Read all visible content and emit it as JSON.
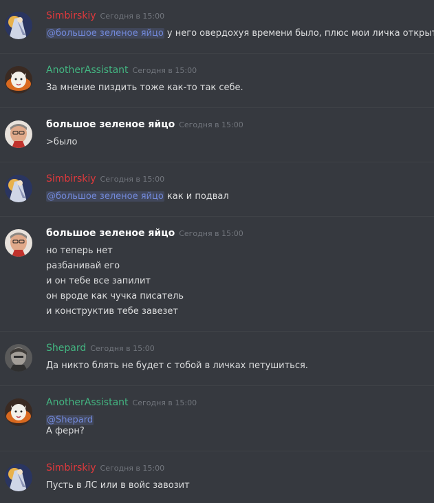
{
  "colors": {
    "background": "#36393f",
    "divider": "#3f4247",
    "timestamp": "#72767d",
    "text": "#dcddde",
    "mention": "#7289da",
    "simbirskiy": "#e0393c",
    "anotherassistant": "#43b581",
    "egg": "#ffffff",
    "shepard": "#43b581"
  },
  "messages": [
    {
      "author": "Simbirskiy",
      "timestamp": "Сегодня в 15:00",
      "mention": "@большое зеленое яйцо",
      "text": " у него овердохуя времени было, плюс мои личка открыта"
    },
    {
      "author": "AnotherAssistant",
      "timestamp": "Сегодня в 15:00",
      "text": "За мнение пиздить тоже как-то так себе."
    },
    {
      "author": "большое зеленое яйцо",
      "timestamp": "Сегодня в 15:00",
      "text": ">было"
    },
    {
      "author": "Simbirskiy",
      "timestamp": "Сегодня в 15:00",
      "mention": "@большое зеленое яйцо",
      "text": " как и подвал"
    },
    {
      "author": "большое зеленое яйцо",
      "timestamp": "Сегодня в 15:00",
      "lines": [
        "но теперь нет",
        "разбанивай его",
        "и он тебе все запилит",
        "он вроде как чучка писатель",
        "и конструктив тебе завезет"
      ]
    },
    {
      "author": "Shepard",
      "timestamp": "Сегодня в 15:00",
      "text": "Да никто блять не будет с тобой в личках петушиться."
    },
    {
      "author": "AnotherAssistant",
      "timestamp": "Сегодня в 15:00",
      "mention": "@Shepard",
      "text2": "А ферн?"
    },
    {
      "author": "Simbirskiy",
      "timestamp": "Сегодня в 15:00",
      "text": "Пусть в ЛС или в войс завозит"
    }
  ]
}
